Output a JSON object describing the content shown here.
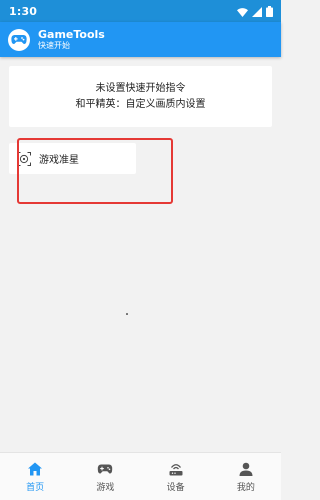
{
  "status_bar": {
    "time": "1:30",
    "icons": [
      "wifi-icon",
      "signal-icon",
      "battery-icon"
    ]
  },
  "app_bar": {
    "title": "GameTools",
    "subtitle": "快速开始",
    "logo_icon": "gamepad-icon"
  },
  "info_card": {
    "line1": "未设置快速开始指令",
    "line2": "和平精英：自定义画质内设置"
  },
  "feature": {
    "label": "游戏准星",
    "icon": "crosshair-icon"
  },
  "bottom_nav": {
    "items": [
      {
        "label": "首页",
        "icon": "home-icon",
        "active": true
      },
      {
        "label": "游戏",
        "icon": "gamepad-icon",
        "active": false
      },
      {
        "label": "设备",
        "icon": "router-icon",
        "active": false
      },
      {
        "label": "我的",
        "icon": "person-icon",
        "active": false
      }
    ]
  },
  "colors": {
    "primary": "#2196f3",
    "status_bar": "#1e8fd8",
    "highlight": "#e53935",
    "background": "#f2f2f2"
  }
}
